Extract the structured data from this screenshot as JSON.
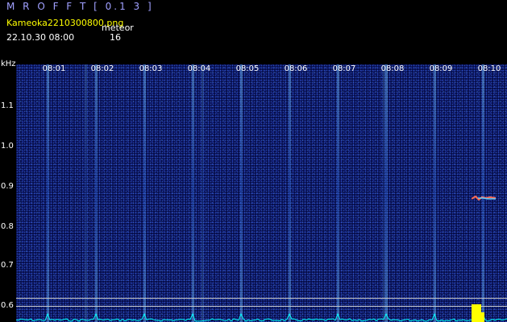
{
  "header": {
    "app_title": "M R O F F T [ 0.1 3 ]",
    "filename": "Kameoka2210300800.png",
    "meteor_label": "meteor",
    "datetime": "22.10.30 08:00",
    "meteor_count": "16"
  },
  "axis": {
    "y_unit": "kHz",
    "y_ticks": [
      "1.1",
      "1.0",
      "0.9",
      "0.8",
      "0.7",
      "0.6"
    ],
    "x_ticks": [
      "08:01",
      "08:02",
      "08:03",
      "08:04",
      "08:05",
      "08:06",
      "08:07",
      "08:08",
      "08:09",
      "08:10"
    ]
  },
  "colors": {
    "text": "#ffffff",
    "header_text": "#ffff00",
    "title_text": "#a0a0ff",
    "background": "#000000",
    "spectrogram": "#050a45",
    "trace": "#00ffff",
    "signal": "#ffff00"
  }
}
